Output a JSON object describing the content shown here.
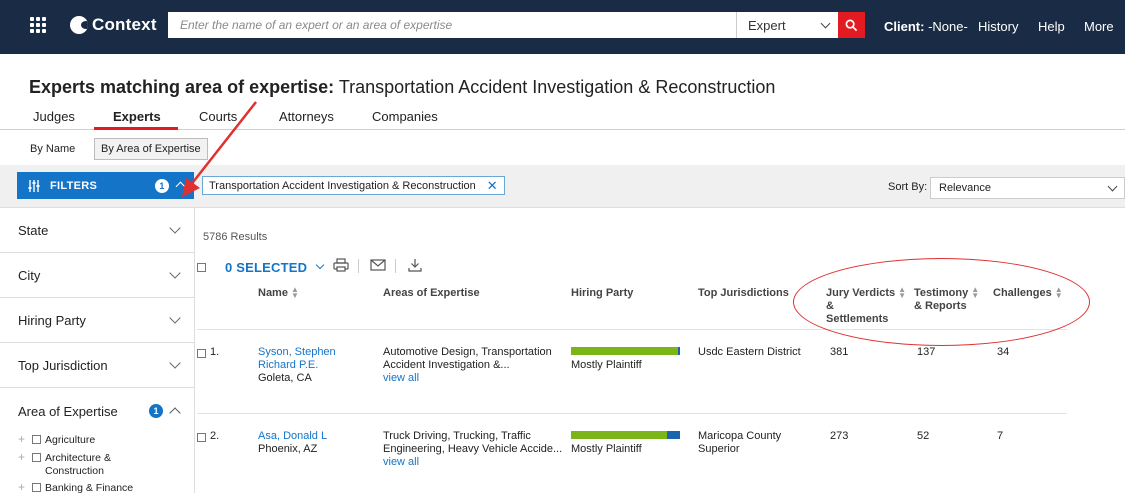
{
  "topbar": {
    "logo_text": "Context",
    "search_placeholder": "Enter the name of an expert or an area of expertise",
    "search_type": "Expert",
    "client_label": "Client:",
    "client_value": "-None-",
    "links": {
      "history": "History",
      "help": "Help",
      "more": "More"
    }
  },
  "page": {
    "title_strong": "Experts matching area of expertise:",
    "title_rest": "Transportation Accident Investigation & Reconstruction"
  },
  "tabs": [
    "Judges",
    "Experts",
    "Courts",
    "Attorneys",
    "Companies"
  ],
  "active_tab": "Experts",
  "subtoggles": {
    "by_name": "By Name",
    "by_area": "By Area of Expertise"
  },
  "filterbar": {
    "filters_label": "FILTERS",
    "filters_count": "1",
    "chip_label": "Transportation Accident Investigation & Reconstruction",
    "chip_remove": "✕",
    "sort_label": "Sort By:",
    "sort_value": "Relevance"
  },
  "sidebar": {
    "facets": [
      "State",
      "City",
      "Hiring Party",
      "Top Jurisdiction"
    ],
    "area_facet": {
      "label": "Area of Expertise",
      "count": "1"
    },
    "tree_items": [
      "Agriculture",
      "Architecture & Construction",
      "Banking & Finance"
    ]
  },
  "results": {
    "count": "5786 Results",
    "selected_label": "0 SELECTED",
    "columns": {
      "name": "Name",
      "areas": "Areas of Expertise",
      "hiring": "Hiring Party",
      "juris": "Top Jurisdictions",
      "jury_1": "Jury Verdicts",
      "jury_2": "&",
      "jury_3": "Settlements",
      "testimony_1": "Testimony",
      "testimony_2": "& Reports",
      "challenges": "Challenges"
    },
    "view_all": "view all",
    "rows": [
      {
        "num": "1.",
        "name_1": "Syson, Stephen",
        "name_2": "Richard P.E.",
        "location": "Goleta, CA",
        "areas_1": "Automotive Design, Transportation",
        "areas_2": "Accident Investigation &...",
        "hiring_label": "Mostly Plaintiff",
        "plaintiff_share": 0.98,
        "juris": "Usdc Eastern District",
        "jury": "381",
        "testimony": "137",
        "challenges": "34"
      },
      {
        "num": "2.",
        "name_1": "Asa, Donald L",
        "name_2": "",
        "location": "Phoenix, AZ",
        "areas_1": "Truck Driving, Trucking, Traffic",
        "areas_2": "Engineering, Heavy Vehicle Accide...",
        "hiring_label": "Mostly Plaintiff",
        "plaintiff_share": 0.88,
        "juris_1": "Maricopa County",
        "juris_2": "Superior",
        "jury": "273",
        "testimony": "52",
        "challenges": "7"
      }
    ]
  },
  "colors": {
    "nav_bg": "#1a2c45",
    "accent_red": "#e21a22",
    "primary_blue": "#1474c8",
    "plaintiff_green": "#7cb518",
    "defense_blue": "#1c63b0",
    "annotation_red": "#e03030"
  }
}
